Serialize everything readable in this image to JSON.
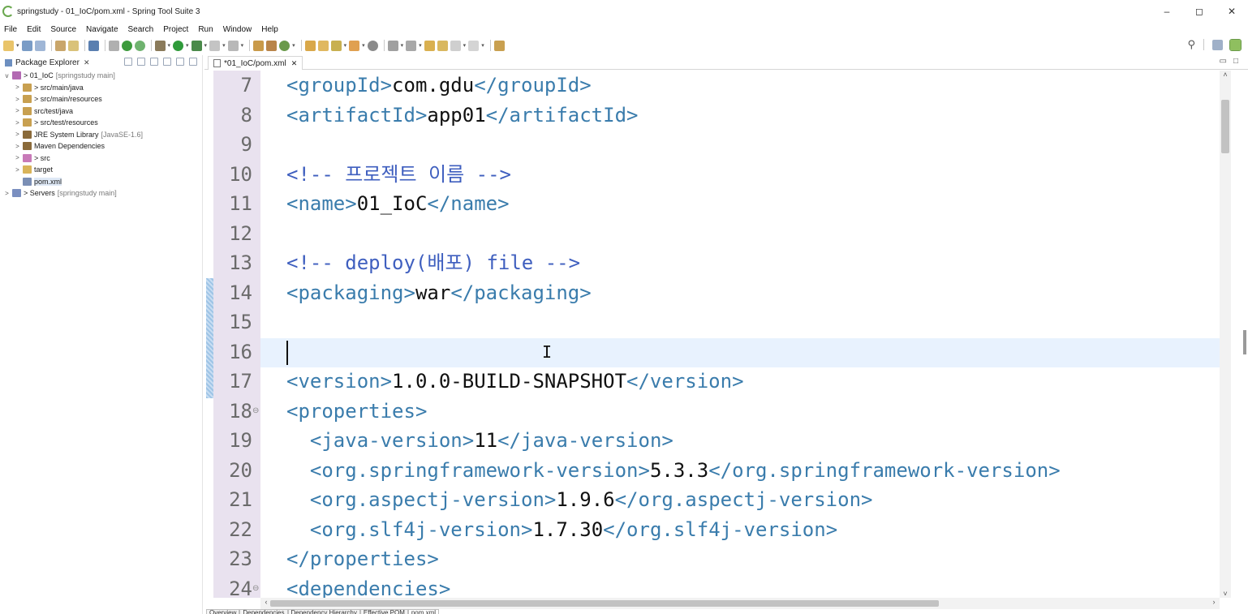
{
  "window": {
    "title": "springstudy - 01_IoC/pom.xml - Spring Tool Suite 3",
    "controls": [
      "–",
      "◻",
      "✕"
    ]
  },
  "menu": [
    "File",
    "Edit",
    "Source",
    "Navigate",
    "Search",
    "Project",
    "Run",
    "Window",
    "Help"
  ],
  "explorer": {
    "title": "Package Explorer",
    "tree": [
      {
        "arrow": "v",
        "label": "> 01_IoC",
        "decor": "[springstudy main]",
        "indent": 0,
        "icon_color": "#b36ab3"
      },
      {
        "arrow": ">",
        "label": "> src/main/java",
        "decor": "",
        "indent": 1,
        "icon_color": "#c8a050"
      },
      {
        "arrow": ">",
        "label": "> src/main/resources",
        "decor": "",
        "indent": 1,
        "icon_color": "#c8a050"
      },
      {
        "arrow": ">",
        "label": "src/test/java",
        "decor": "",
        "indent": 1,
        "icon_color": "#c8a050"
      },
      {
        "arrow": ">",
        "label": "> src/test/resources",
        "decor": "",
        "indent": 1,
        "icon_color": "#c8a050"
      },
      {
        "arrow": ">",
        "label": "JRE System Library",
        "decor": "[JavaSE-1.6]",
        "indent": 1,
        "icon_color": "#8a6a3a"
      },
      {
        "arrow": ">",
        "label": "Maven Dependencies",
        "decor": "",
        "indent": 1,
        "icon_color": "#8a6a3a"
      },
      {
        "arrow": ">",
        "label": "> src",
        "decor": "",
        "indent": 1,
        "icon_color": "#c87ab8"
      },
      {
        "arrow": ">",
        "label": "target",
        "decor": "",
        "indent": 1,
        "icon_color": "#d9b45a"
      },
      {
        "arrow": "",
        "label": "pom.xml",
        "decor": "",
        "indent": 1,
        "icon_color": "#7b8fb5",
        "selected": true
      },
      {
        "arrow": ">",
        "label": "> Servers",
        "decor": "[springstudy main]",
        "indent": 0,
        "icon_color": "#7a8fc0"
      }
    ]
  },
  "editor": {
    "tab_label": "*01_IoC/pom.xml",
    "lines": [
      {
        "num": "7",
        "parts": [
          [
            "tag",
            "<groupId>"
          ],
          [
            "txt",
            "com.gdu"
          ],
          [
            "tag",
            "</groupId>"
          ]
        ]
      },
      {
        "num": "8",
        "parts": [
          [
            "tag",
            "<artifactId>"
          ],
          [
            "txt",
            "app01"
          ],
          [
            "tag",
            "</artifactId>"
          ]
        ]
      },
      {
        "num": "9",
        "parts": []
      },
      {
        "num": "10",
        "parts": [
          [
            "comment",
            "<!-- 프로젝트 이름 -->"
          ]
        ]
      },
      {
        "num": "11",
        "parts": [
          [
            "tag",
            "<name>"
          ],
          [
            "txt",
            "01_IoC"
          ],
          [
            "tag",
            "</name>"
          ]
        ]
      },
      {
        "num": "12",
        "parts": []
      },
      {
        "num": "13",
        "parts": [
          [
            "comment",
            "<!-- deploy(배포) file -->"
          ]
        ]
      },
      {
        "num": "14",
        "parts": [
          [
            "tag",
            "<packaging>"
          ],
          [
            "txt",
            "war"
          ],
          [
            "tag",
            "</packaging>"
          ]
        ]
      },
      {
        "num": "15",
        "parts": []
      },
      {
        "num": "16",
        "parts": []
      },
      {
        "num": "17",
        "parts": [
          [
            "tag",
            "<version>"
          ],
          [
            "txt",
            "1.0.0-BUILD-SNAPSHOT"
          ],
          [
            "tag",
            "</version>"
          ]
        ]
      },
      {
        "num": "18",
        "fold": true,
        "parts": [
          [
            "tag",
            "<properties>"
          ]
        ]
      },
      {
        "num": "19",
        "parts": [
          [
            "txt",
            "  "
          ],
          [
            "tag",
            "<java-version>"
          ],
          [
            "txt",
            "11"
          ],
          [
            "tag",
            "</java-version>"
          ]
        ]
      },
      {
        "num": "20",
        "parts": [
          [
            "txt",
            "  "
          ],
          [
            "tag",
            "<org.springframework-version>"
          ],
          [
            "txt",
            "5.3.3"
          ],
          [
            "tag",
            "</org.springframework-version>"
          ]
        ]
      },
      {
        "num": "21",
        "parts": [
          [
            "txt",
            "  "
          ],
          [
            "tag",
            "<org.aspectj-version>"
          ],
          [
            "txt",
            "1.9.6"
          ],
          [
            "tag",
            "</org.aspectj-version>"
          ]
        ]
      },
      {
        "num": "22",
        "parts": [
          [
            "txt",
            "  "
          ],
          [
            "tag",
            "<org.slf4j-version>"
          ],
          [
            "txt",
            "1.7.30"
          ],
          [
            "tag",
            "</org.slf4j-version>"
          ]
        ]
      },
      {
        "num": "23",
        "parts": [
          [
            "tag",
            "</properties>"
          ]
        ]
      },
      {
        "num": "24",
        "fold": true,
        "parts": [
          [
            "tag",
            "<dependencies>"
          ]
        ]
      }
    ],
    "current_line": "16"
  },
  "bottom_tabs": [
    "Overview",
    "Dependencies",
    "Dependency Hierarchy",
    "Effective POM",
    "pom.xml"
  ],
  "colors": {
    "tag": "#3a7cac",
    "comment": "#3f5fbf",
    "gutter": "#e9e2ef",
    "current_line": "#e8f2fe"
  }
}
